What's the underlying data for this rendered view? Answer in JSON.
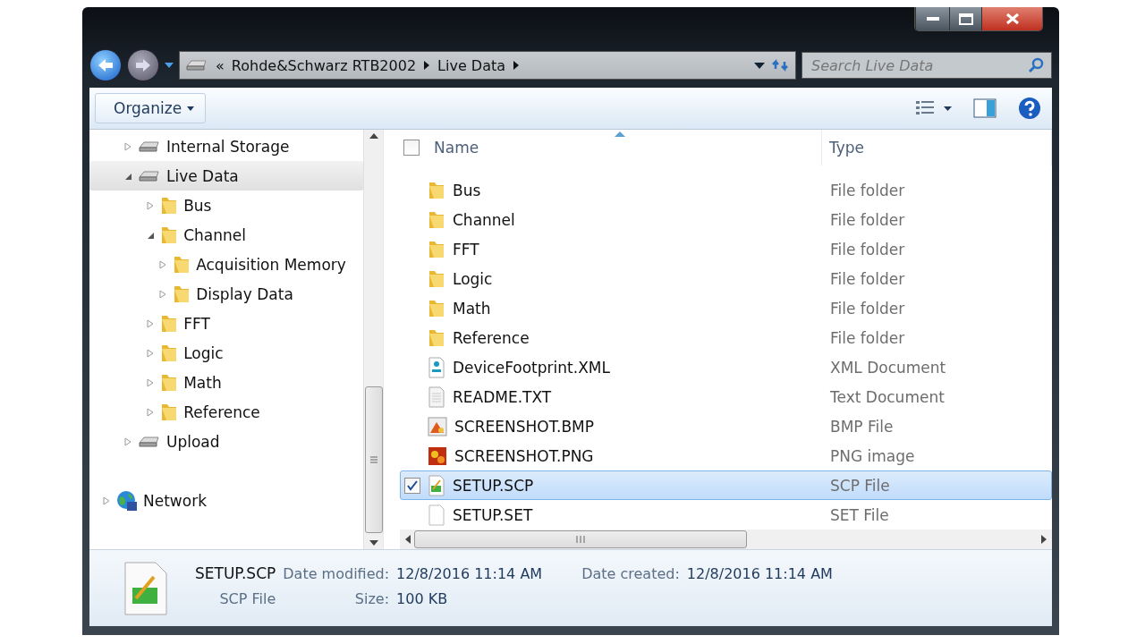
{
  "address": {
    "overflow": "«",
    "crumbs": [
      "Rohde&Schwarz RTB2002",
      "Live Data"
    ]
  },
  "search": {
    "placeholder": "Search Live Data"
  },
  "toolbar": {
    "organize": "Organize"
  },
  "nav": [
    {
      "label": "Internal Storage",
      "kind": "drive",
      "expanded": false,
      "selected": false
    },
    {
      "label": "Live Data",
      "kind": "drive",
      "expanded": true,
      "selected": true,
      "children": [
        {
          "label": "Bus",
          "kind": "folder",
          "expanded": false,
          "selected": false
        },
        {
          "label": "Channel",
          "kind": "folder",
          "expanded": true,
          "selected": false,
          "children": [
            {
              "label": "Acquisition Memory",
              "kind": "folder",
              "expanded": false,
              "selected": false
            },
            {
              "label": "Display Data",
              "kind": "folder",
              "expanded": false,
              "selected": false
            }
          ]
        },
        {
          "label": "FFT",
          "kind": "folder",
          "expanded": false,
          "selected": false
        },
        {
          "label": "Logic",
          "kind": "folder",
          "expanded": false,
          "selected": false
        },
        {
          "label": "Math",
          "kind": "folder",
          "expanded": false,
          "selected": false
        },
        {
          "label": "Reference",
          "kind": "folder",
          "expanded": false,
          "selected": false
        }
      ]
    },
    {
      "label": "Upload",
      "kind": "drive",
      "expanded": false,
      "selected": false
    },
    {
      "label": "Network",
      "kind": "network",
      "expanded": false,
      "selected": false
    }
  ],
  "columns": {
    "select_all_checked": false,
    "name": "Name",
    "type": "Type"
  },
  "files": [
    {
      "name": "Bus",
      "type": "File folder",
      "kind": "folder",
      "selected": false,
      "checked": false
    },
    {
      "name": "Channel",
      "type": "File folder",
      "kind": "folder",
      "selected": false,
      "checked": false
    },
    {
      "name": "FFT",
      "type": "File folder",
      "kind": "folder",
      "selected": false,
      "checked": false
    },
    {
      "name": "Logic",
      "type": "File folder",
      "kind": "folder",
      "selected": false,
      "checked": false
    },
    {
      "name": "Math",
      "type": "File folder",
      "kind": "folder",
      "selected": false,
      "checked": false
    },
    {
      "name": "Reference",
      "type": "File folder",
      "kind": "folder",
      "selected": false,
      "checked": false
    },
    {
      "name": "DeviceFootprint.XML",
      "type": "XML Document",
      "kind": "xml",
      "selected": false,
      "checked": false
    },
    {
      "name": "README.TXT",
      "type": "Text Document",
      "kind": "text",
      "selected": false,
      "checked": false
    },
    {
      "name": "SCREENSHOT.BMP",
      "type": "BMP File",
      "kind": "bmp",
      "selected": false,
      "checked": false
    },
    {
      "name": "SCREENSHOT.PNG",
      "type": "PNG image",
      "kind": "png",
      "selected": false,
      "checked": false
    },
    {
      "name": "SETUP.SCP",
      "type": "SCP File",
      "kind": "scp",
      "selected": true,
      "checked": true
    },
    {
      "name": "SETUP.SET",
      "type": "SET File",
      "kind": "set",
      "selected": false,
      "checked": false
    }
  ],
  "details": {
    "name": "SETUP.SCP",
    "type": "SCP File",
    "fields": [
      {
        "label": "Date modified:",
        "value": "12/8/2016 11:14 AM"
      },
      {
        "label": "Date created:",
        "value": "12/8/2016 11:14 AM"
      },
      {
        "label": "Size:",
        "value": "100 KB"
      }
    ]
  }
}
